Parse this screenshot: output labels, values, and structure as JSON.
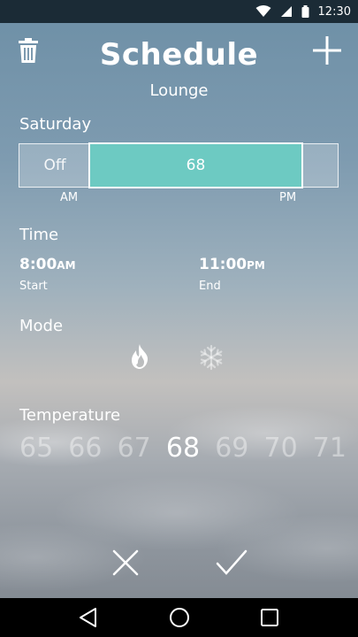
{
  "status_bar": {
    "time": "12:30",
    "icons": [
      "wifi-icon",
      "signal-icon",
      "battery-icon"
    ]
  },
  "header": {
    "title": "Schedule",
    "subtitle": "Lounge",
    "left_icon": "trash-icon",
    "right_icon": "plus-icon"
  },
  "day": {
    "label": "Saturday"
  },
  "schedule_bar": {
    "off_label": "Off",
    "range_value": "68",
    "am_label": "AM",
    "pm_label": "PM",
    "accent_color": "#6dcac2"
  },
  "time": {
    "label": "Time",
    "start": {
      "value": "8:00",
      "ampm": "AM",
      "caption": "Start"
    },
    "end": {
      "value": "11:00",
      "ampm": "PM",
      "caption": "End"
    }
  },
  "mode": {
    "label": "Mode",
    "options": [
      "heat-icon",
      "cool-icon"
    ],
    "selected": "heat-icon"
  },
  "temperature": {
    "label": "Temperature",
    "values": [
      "65",
      "66",
      "67",
      "68",
      "69",
      "70",
      "71"
    ],
    "selected": "68"
  },
  "actions": {
    "cancel_icon": "close-icon",
    "confirm_icon": "check-icon"
  },
  "nav_bar": {
    "icons": [
      "back-icon",
      "home-icon",
      "recents-icon"
    ]
  }
}
